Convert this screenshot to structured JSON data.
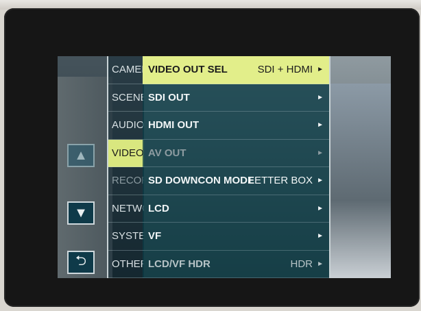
{
  "nav": {
    "up_icon": "▲",
    "down_icon": "▼",
    "back_icon": "⮌"
  },
  "categories": [
    {
      "label": "CAMERA",
      "state": "normal"
    },
    {
      "label": "SCENE",
      "state": "normal"
    },
    {
      "label": "AUDIO",
      "state": "normal"
    },
    {
      "label": "VIDEO",
      "state": "active"
    },
    {
      "label": "RECORDING",
      "state": "dim"
    },
    {
      "label": "NETWORK",
      "state": "normal"
    },
    {
      "label": "SYSTEM",
      "state": "normal"
    },
    {
      "label": "OTHERS",
      "state": "normal"
    }
  ],
  "items": [
    {
      "label": "VIDEO OUT SEL",
      "value": "SDI + HDMI",
      "arrow": "►",
      "state": "selected"
    },
    {
      "label": "SDI OUT",
      "value": "",
      "arrow": "►",
      "state": "normal"
    },
    {
      "label": "HDMI OUT",
      "value": "",
      "arrow": "►",
      "state": "normal"
    },
    {
      "label": "AV OUT",
      "value": "",
      "arrow": "►",
      "state": "dim"
    },
    {
      "label": "SD DOWNCON MODE",
      "value": "LETTER BOX",
      "arrow": "►",
      "state": "normal"
    },
    {
      "label": "LCD",
      "value": "",
      "arrow": "►",
      "state": "normal"
    },
    {
      "label": "VF",
      "value": "",
      "arrow": "►",
      "state": "normal"
    },
    {
      "label": "LCD/VF HDR",
      "value": "HDR",
      "arrow": "►",
      "state": "faded"
    }
  ],
  "colors": {
    "highlight": "#e2ee8a",
    "panel": "#0c3c46",
    "bezel": "#161616"
  }
}
